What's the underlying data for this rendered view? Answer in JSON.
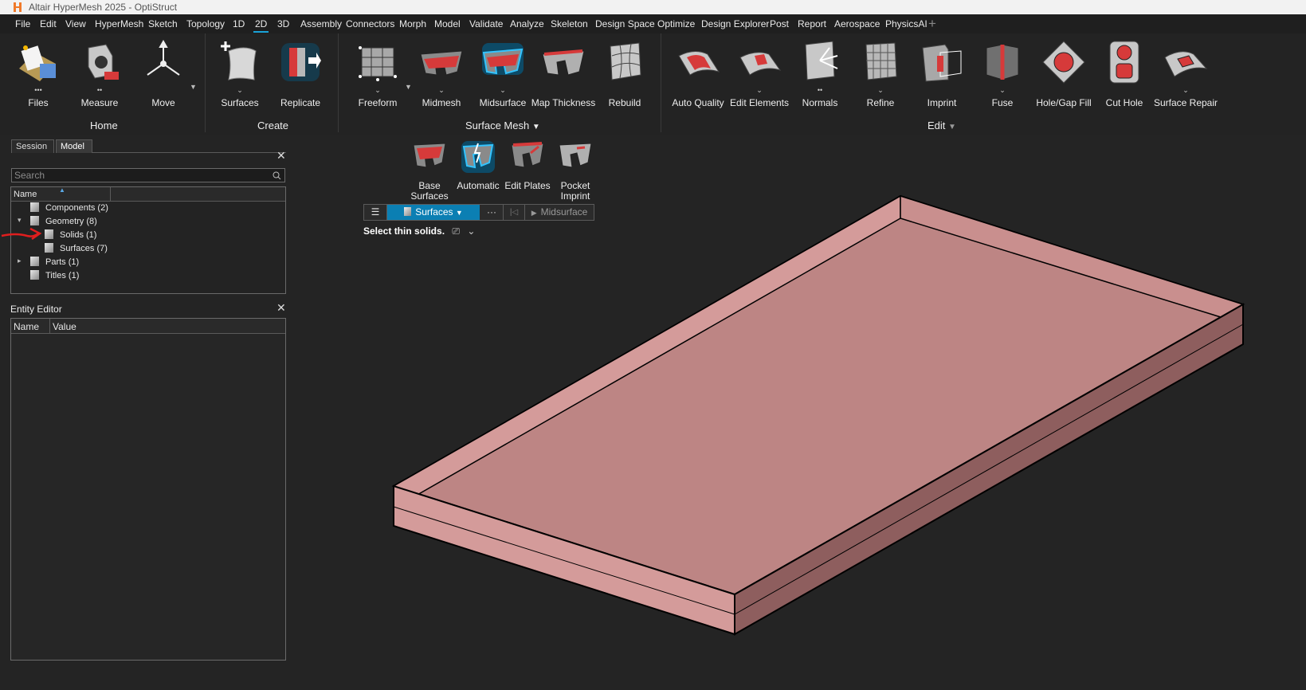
{
  "window": {
    "title": "Altair HyperMesh 2025 - OptiStruct"
  },
  "menu": [
    "File",
    "Edit",
    "View",
    "HyperMesh",
    "Sketch",
    "Topology",
    "1D",
    "2D",
    "3D",
    "Assembly",
    "Connectors",
    "Morph",
    "Model",
    "Validate",
    "Analyze",
    "Skeleton",
    "Design Space",
    "Optimize",
    "Design Explorer",
    "Post",
    "Report",
    "Aerospace",
    "PhysicsAI",
    "+"
  ],
  "menu_active": "2D",
  "ribbon": {
    "tools": [
      "Files",
      "Measure",
      "Move",
      "Surfaces",
      "Replicate",
      "Freeform",
      "Midmesh",
      "Midsurface",
      "Map Thickness",
      "Rebuild",
      "Auto Quality",
      "Edit Elements",
      "Normals",
      "Refine",
      "Imprint",
      "Fuse",
      "Hole/Gap Fill",
      "Cut Hole",
      "Surface Repair"
    ],
    "groups": [
      "Home",
      "Create",
      "Surface Mesh",
      "Edit"
    ]
  },
  "panel_tabs": [
    "Session",
    "Model"
  ],
  "search": {
    "placeholder": "Search"
  },
  "tree": {
    "column": "Name",
    "rows": [
      "Components  (2)",
      "Geometry  (8)",
      "Solids  (1)",
      "Surfaces  (7)",
      "Parts  (1)",
      "Titles  (1)"
    ]
  },
  "entity_editor": {
    "title": "Entity Editor",
    "col_name": "Name",
    "col_value": "Value"
  },
  "midsurface_tools": [
    "Base Surfaces",
    "Automatic",
    "Edit Plates",
    "Pocket Imprint"
  ],
  "guide_bar": {
    "selector": "Surfaces",
    "more": "···",
    "action": "Midsurface"
  },
  "hint": "Select thin solids.",
  "colors": {
    "accent": "#1aa3d8",
    "selector_bg": "#0b7fb3",
    "plate_top": "#bd8584",
    "plate_side": "#d49b9a",
    "plate_side_dark": "#8e5e5e",
    "annotation_red": "#e01e1e"
  }
}
